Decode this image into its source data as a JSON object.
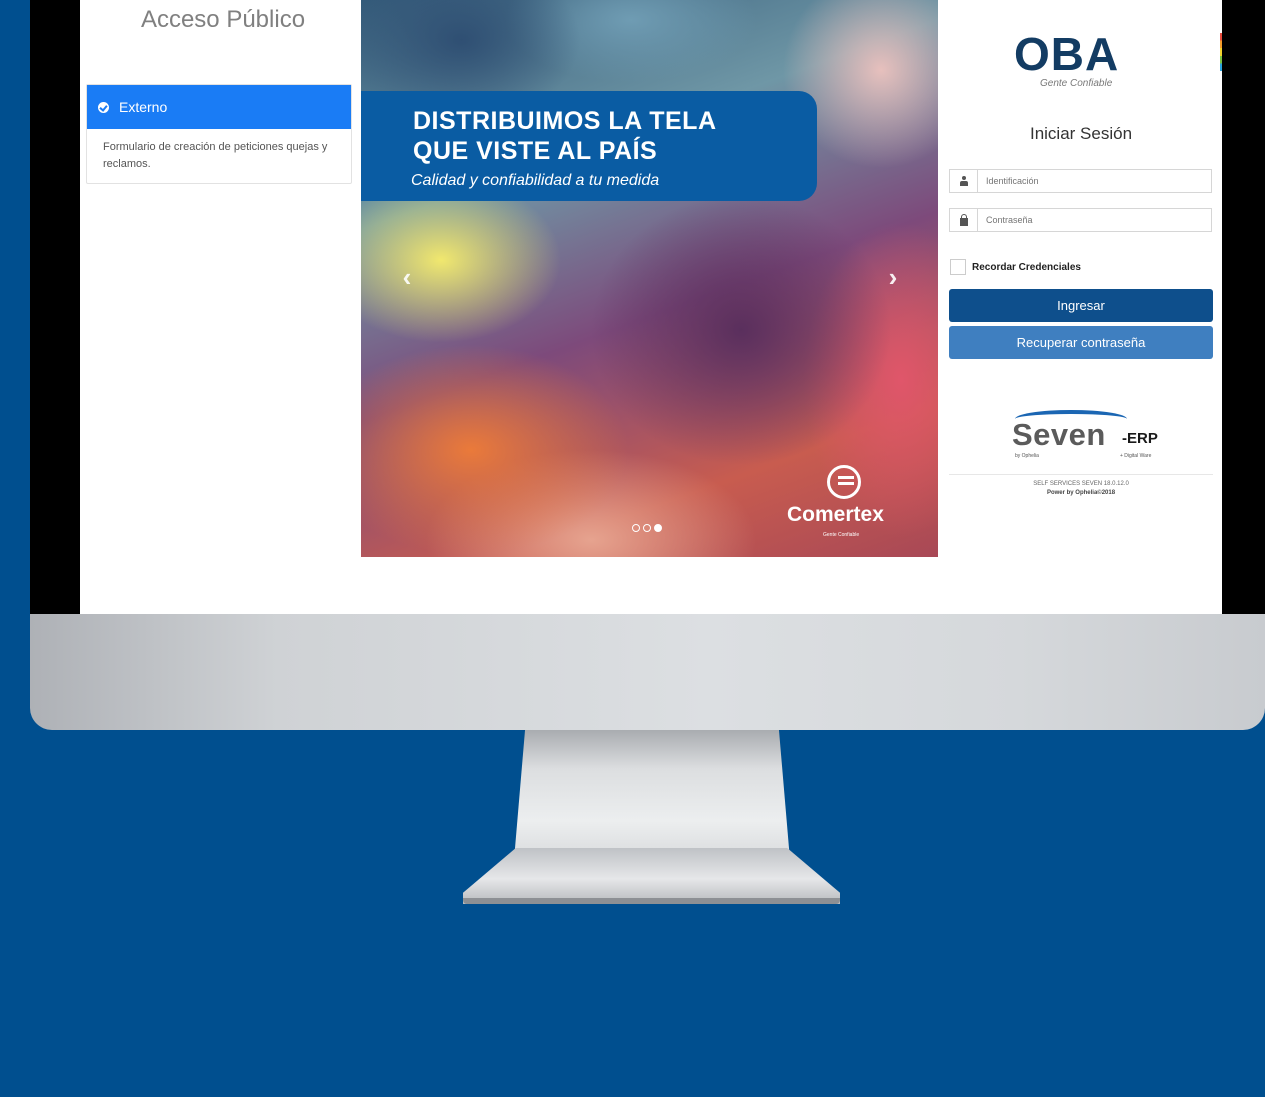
{
  "public_access": {
    "title": "Acceso Público",
    "panel": {
      "header": "Externo",
      "description": "Formulario de creación de peticiones quejas y reclamos."
    }
  },
  "carousel": {
    "headline_line1": "DISTRIBUIMOS LA TELA",
    "headline_line2": "QUE VISTE AL PAÍS",
    "tagline": "Calidad y confiabilidad a tu medida",
    "brand_name": "Comertex",
    "brand_sub": "Gente Confiable",
    "prev_glyph": "‹",
    "next_glyph": "›",
    "slide_count": 3,
    "active_slide": 3
  },
  "login": {
    "logo_text": "OBA",
    "logo_tagline": "Gente Confiable",
    "title": "Iniciar Sesión",
    "id_placeholder": "Identificación",
    "password_placeholder": "Contraseña",
    "remember_label": "Recordar Credenciales",
    "login_button": "Ingresar",
    "recover_button": "Recuperar contraseña",
    "seven_logo": "Seven",
    "seven_suffix": "-ERP",
    "seven_small_left": "by Ophelia",
    "seven_small_right": "+ Digital Ware",
    "footer_line1": "SELF SERVICES SEVEN 18.0.12.0",
    "footer_line2": "Power by Ophelia©2018"
  },
  "colors": {
    "background": "#004f8f",
    "panel_header": "#1a7cf5",
    "primary_button": "#0e4f8c",
    "secondary_button": "#3f7fc0",
    "banner": "#0a5ca3"
  }
}
